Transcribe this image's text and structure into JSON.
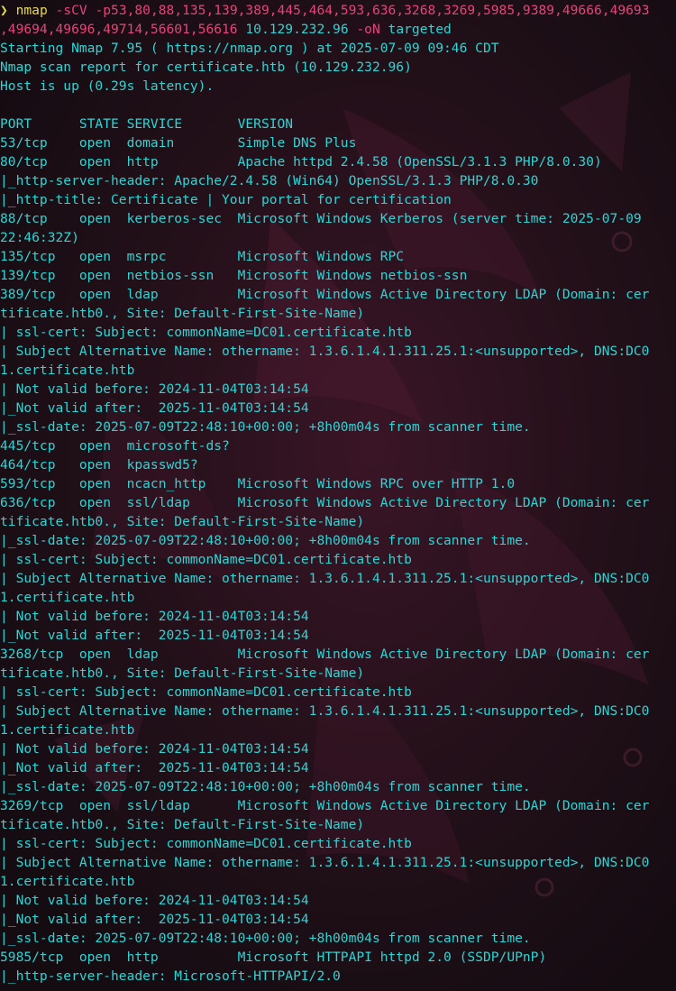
{
  "command": {
    "prompt_symbol": "❯",
    "program": "nmap",
    "flags_line1": " -sCV -p53,80,88,135,139,389,445,464,593,636,3268,3269,5985,9389,49666,49693",
    "flags_line2": ",49694,49696,49714,56601,56616",
    "target_ip": " 10.129.232.96",
    "output_flag": " -oN",
    "output_file": " targeted"
  },
  "output_lines": [
    "Starting Nmap 7.95 ( https://nmap.org ) at 2025-07-09 09:46 CDT",
    "Nmap scan report for certificate.htb (10.129.232.96)",
    "Host is up (0.29s latency).",
    "",
    "PORT      STATE SERVICE       VERSION",
    "53/tcp    open  domain        Simple DNS Plus",
    "80/tcp    open  http          Apache httpd 2.4.58 (OpenSSL/3.1.3 PHP/8.0.30)",
    "|_http-server-header: Apache/2.4.58 (Win64) OpenSSL/3.1.3 PHP/8.0.30",
    "|_http-title: Certificate | Your portal for certification",
    "88/tcp    open  kerberos-sec  Microsoft Windows Kerberos (server time: 2025-07-09",
    "22:46:32Z)",
    "135/tcp   open  msrpc         Microsoft Windows RPC",
    "139/tcp   open  netbios-ssn   Microsoft Windows netbios-ssn",
    "389/tcp   open  ldap          Microsoft Windows Active Directory LDAP (Domain: cer",
    "tificate.htb0., Site: Default-First-Site-Name)",
    "| ssl-cert: Subject: commonName=DC01.certificate.htb",
    "| Subject Alternative Name: othername: 1.3.6.1.4.1.311.25.1:<unsupported>, DNS:DC0",
    "1.certificate.htb",
    "| Not valid before: 2024-11-04T03:14:54",
    "|_Not valid after:  2025-11-04T03:14:54",
    "|_ssl-date: 2025-07-09T22:48:10+00:00; +8h00m04s from scanner time.",
    "445/tcp   open  microsoft-ds?",
    "464/tcp   open  kpasswd5?",
    "593/tcp   open  ncacn_http    Microsoft Windows RPC over HTTP 1.0",
    "636/tcp   open  ssl/ldap      Microsoft Windows Active Directory LDAP (Domain: cer",
    "tificate.htb0., Site: Default-First-Site-Name)",
    "|_ssl-date: 2025-07-09T22:48:10+00:00; +8h00m04s from scanner time.",
    "| ssl-cert: Subject: commonName=DC01.certificate.htb",
    "| Subject Alternative Name: othername: 1.3.6.1.4.1.311.25.1:<unsupported>, DNS:DC0",
    "1.certificate.htb",
    "| Not valid before: 2024-11-04T03:14:54",
    "|_Not valid after:  2025-11-04T03:14:54",
    "3268/tcp  open  ldap          Microsoft Windows Active Directory LDAP (Domain: cer",
    "tificate.htb0., Site: Default-First-Site-Name)",
    "| ssl-cert: Subject: commonName=DC01.certificate.htb",
    "| Subject Alternative Name: othername: 1.3.6.1.4.1.311.25.1:<unsupported>, DNS:DC0",
    "1.certificate.htb",
    "| Not valid before: 2024-11-04T03:14:54",
    "|_Not valid after:  2025-11-04T03:14:54",
    "|_ssl-date: 2025-07-09T22:48:10+00:00; +8h00m04s from scanner time.",
    "3269/tcp  open  ssl/ldap      Microsoft Windows Active Directory LDAP (Domain: cer",
    "tificate.htb0., Site: Default-First-Site-Name)",
    "| ssl-cert: Subject: commonName=DC01.certificate.htb",
    "| Subject Alternative Name: othername: 1.3.6.1.4.1.311.25.1:<unsupported>, DNS:DC0",
    "1.certificate.htb",
    "| Not valid before: 2024-11-04T03:14:54",
    "|_Not valid after:  2025-11-04T03:14:54",
    "|_ssl-date: 2025-07-09T22:48:10+00:00; +8h00m04s from scanner time.",
    "5985/tcp  open  http          Microsoft HTTPAPI httpd 2.0 (SSDP/UPnP)",
    "|_http-server-header: Microsoft-HTTPAPI/2.0"
  ],
  "colors": {
    "background": "#1a1018",
    "output_text": "#2fd4d4",
    "command_name": "#e9d84a",
    "command_flags": "#e8437a",
    "wallpaper_accent": "#5a1a30"
  }
}
